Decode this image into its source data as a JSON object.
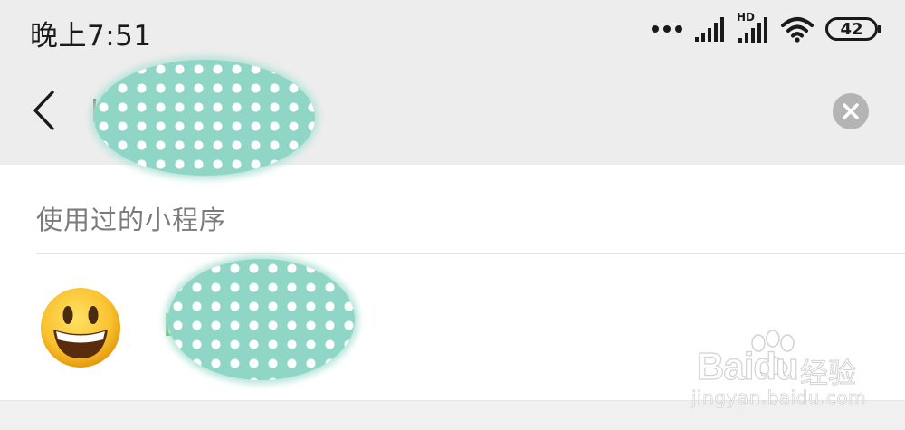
{
  "status_bar": {
    "time": "晚上7:51",
    "network_badge": "HD",
    "battery_level": "42",
    "icons": [
      "more-dots-icon",
      "signal-icon",
      "hd-signal-icon",
      "wifi-icon",
      "battery-icon"
    ]
  },
  "search_bar": {
    "query": "b",
    "icons": [
      "back-arrow-icon",
      "clear-icon"
    ]
  },
  "section": {
    "title": "使用过的小程序"
  },
  "results": [
    {
      "name": "B",
      "icon": "grinning-face-emoji"
    }
  ],
  "watermark": {
    "brand": "Baidu",
    "suffix": "经验",
    "url": "jingyan.baidu.com"
  },
  "colors": {
    "header_bg": "#ededed",
    "result_text": "#1aad19",
    "redaction": "#8fd6c6"
  }
}
